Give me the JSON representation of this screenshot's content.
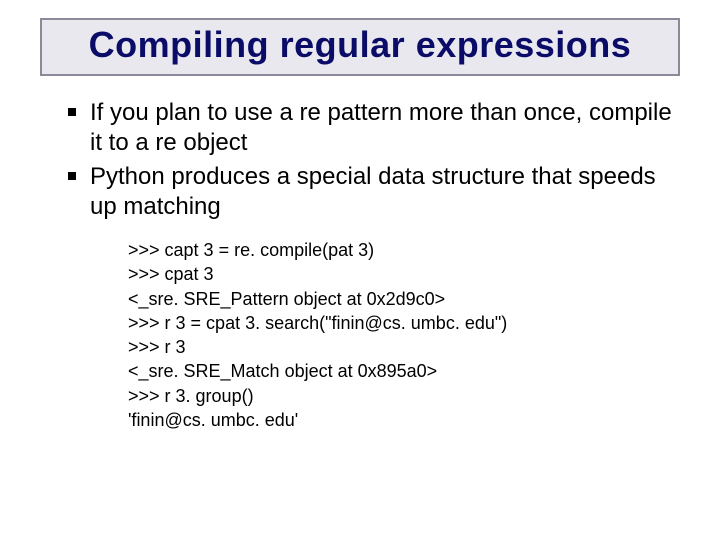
{
  "title": "Compiling regular expressions",
  "bullets": [
    "If you plan to use a re pattern more than once, compile it to a re object",
    "Python produces a special data structure that speeds up matching"
  ],
  "code_lines": [
    ">>> capt 3 = re. compile(pat 3)",
    ">>> cpat 3",
    "<_sre. SRE_Pattern object at 0x2d9c0>",
    ">>> r 3 = cpat 3. search(\"finin@cs. umbc. edu\")",
    ">>> r 3",
    "<_sre. SRE_Match object at 0x895a0>",
    ">>> r 3. group()",
    "'finin@cs. umbc. edu'"
  ]
}
